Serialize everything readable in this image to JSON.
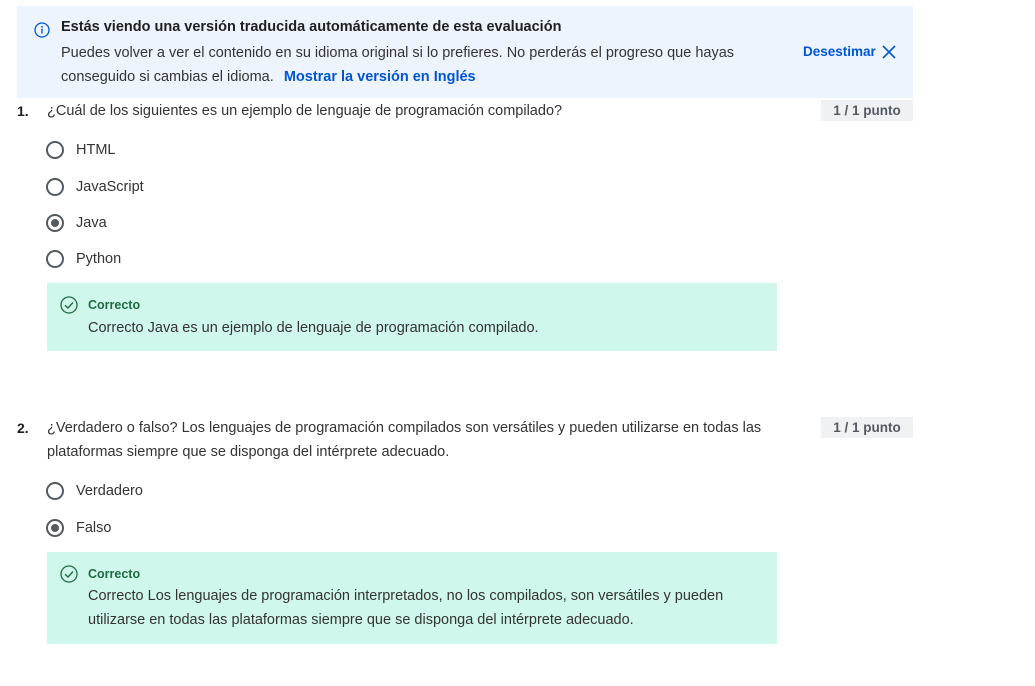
{
  "banner": {
    "title": "Estás viendo una versión traducida automáticamente de esta evaluación",
    "body": "Puedes volver a ver el contenido en su idioma original si lo prefieres. No perderás el progreso que hayas conseguido si cambias el idioma.",
    "show_original_link": "Mostrar la versión en Inglés",
    "dismiss_label": "Desestimar",
    "icons": [
      "info-icon",
      "close-icon"
    ],
    "accent_color": "#0056d2"
  },
  "questions": [
    {
      "number": "1.",
      "text": "¿Cuál de los siguientes es un ejemplo de lenguaje de programación compilado?",
      "points": "1 / 1 punto",
      "options": [
        {
          "label": "HTML",
          "selected": false
        },
        {
          "label": "JavaScript",
          "selected": false
        },
        {
          "label": "Java",
          "selected": true
        },
        {
          "label": "Python",
          "selected": false
        }
      ],
      "feedback": {
        "title": "Correcto",
        "text": "Correcto Java es un ejemplo de lenguaje de programación compilado."
      }
    },
    {
      "number": "2.",
      "text": "¿Verdadero o falso? Los lenguajes de programación compilados son versátiles y pueden utilizarse en todas las plataformas siempre que se disponga del intérprete adecuado.",
      "points": "1 / 1 punto",
      "options": [
        {
          "label": "Verdadero",
          "selected": false
        },
        {
          "label": "Falso",
          "selected": true
        }
      ],
      "feedback": {
        "title": "Correcto",
        "text": "Correcto Los lenguajes de programación interpretados, no los compilados, son versátiles y pueden utilizarse en todas las plataformas siempre que se disponga del intérprete adecuado."
      }
    }
  ],
  "colors": {
    "banner_bg": "#eef4fd",
    "feedback_bg": "#d0f7eb",
    "feedback_title": "#1f6b45",
    "points_bg": "#f0f1f3"
  }
}
